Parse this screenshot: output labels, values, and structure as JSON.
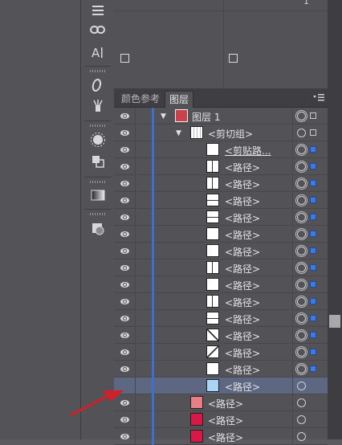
{
  "tabs": {
    "swatch_ref": "颜色参考",
    "layers": "图层"
  },
  "top_panel": {
    "value": "1"
  },
  "rows": [
    {
      "label": "图层 1",
      "indent": 0,
      "twisty": "▼",
      "thumb": "layer",
      "target": "double",
      "sel": "hollow",
      "selected": false,
      "underline": false
    },
    {
      "label": "<剪切组>",
      "indent": 1,
      "twisty": "▼",
      "thumb": "group",
      "target": "single",
      "sel": "hollow",
      "selected": false,
      "underline": false
    },
    {
      "label": "<剪贴路...",
      "indent": 2,
      "twisty": "",
      "thumb": "blank",
      "target": "double",
      "sel": "filled",
      "selected": false,
      "underline": true
    },
    {
      "label": "<路径>",
      "indent": 2,
      "twisty": "",
      "thumb": "vline",
      "target": "double",
      "sel": "filled",
      "selected": false,
      "underline": false
    },
    {
      "label": "<路径>",
      "indent": 2,
      "twisty": "",
      "thumb": "vline",
      "target": "double",
      "sel": "filled",
      "selected": false,
      "underline": false
    },
    {
      "label": "<路径>",
      "indent": 2,
      "twisty": "",
      "thumb": "hline",
      "target": "double",
      "sel": "filled",
      "selected": false,
      "underline": false
    },
    {
      "label": "<路径>",
      "indent": 2,
      "twisty": "",
      "thumb": "hline",
      "target": "double",
      "sel": "filled",
      "selected": false,
      "underline": false
    },
    {
      "label": "<路径>",
      "indent": 2,
      "twisty": "",
      "thumb": "blank",
      "target": "double",
      "sel": "filled",
      "selected": false,
      "underline": false
    },
    {
      "label": "<路径>",
      "indent": 2,
      "twisty": "",
      "thumb": "blank",
      "target": "double",
      "sel": "filled",
      "selected": false,
      "underline": false
    },
    {
      "label": "<路径>",
      "indent": 2,
      "twisty": "",
      "thumb": "vline",
      "target": "double",
      "sel": "filled",
      "selected": false,
      "underline": false
    },
    {
      "label": "<路径>",
      "indent": 2,
      "twisty": "",
      "thumb": "blank",
      "target": "double",
      "sel": "filled",
      "selected": false,
      "underline": false
    },
    {
      "label": "<路径>",
      "indent": 2,
      "twisty": "",
      "thumb": "vline",
      "target": "double",
      "sel": "filled",
      "selected": false,
      "underline": false
    },
    {
      "label": "<路径>",
      "indent": 2,
      "twisty": "",
      "thumb": "hline",
      "target": "double",
      "sel": "filled",
      "selected": false,
      "underline": false
    },
    {
      "label": "<路径>",
      "indent": 2,
      "twisty": "",
      "thumb": "diag",
      "target": "double",
      "sel": "filled",
      "selected": false,
      "underline": false
    },
    {
      "label": "<路径>",
      "indent": 2,
      "twisty": "",
      "thumb": "diag2",
      "target": "double",
      "sel": "filled",
      "selected": false,
      "underline": false
    },
    {
      "label": "<路径>",
      "indent": 2,
      "twisty": "",
      "thumb": "blank",
      "target": "double",
      "sel": "filled",
      "selected": false,
      "underline": false
    },
    {
      "label": "<路径>",
      "indent": 2,
      "twisty": "",
      "thumb": "lightblue",
      "target": "single",
      "sel": "",
      "selected": true,
      "underline": false
    },
    {
      "label": "<路径>",
      "indent": 1,
      "twisty": "",
      "thumb": "pink",
      "target": "single",
      "sel": "",
      "selected": false,
      "underline": false
    },
    {
      "label": "<路径>",
      "indent": 1,
      "twisty": "",
      "thumb": "red",
      "target": "single",
      "sel": "",
      "selected": false,
      "underline": false
    },
    {
      "label": "<路径>",
      "indent": 1,
      "twisty": "",
      "thumb": "red",
      "target": "single",
      "sel": "",
      "selected": false,
      "underline": false
    }
  ],
  "colors": {
    "layer_color": "#3d6fcf",
    "selected_row": "#5d6781",
    "arrow": "#d0202a",
    "pink_swatch": "#e87f86",
    "red_swatch": "#d81848",
    "lightblue_swatch": "#a9d4f5"
  },
  "icons": [
    "menu-lines-icon",
    "link-icon",
    "text-icon",
    "italic-o-icon",
    "brush-icon",
    "sun-icon",
    "pathfinder-icon",
    "gradient-icon",
    "appearance-icon",
    "eye-icon",
    "panel-menu-icon"
  ]
}
